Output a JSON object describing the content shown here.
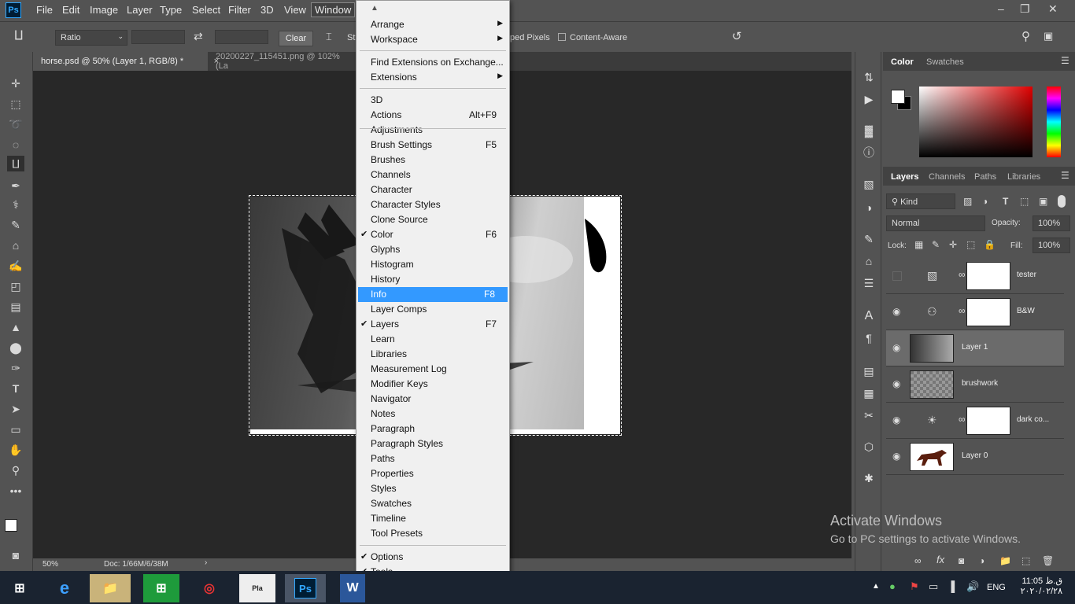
{
  "menubar": {
    "items": [
      "File",
      "Edit",
      "Image",
      "Layer",
      "Type",
      "Select",
      "Filter",
      "3D",
      "View",
      "Window"
    ],
    "active": "Window"
  },
  "options": {
    "ratio": "Ratio",
    "clear": "Clear",
    "delete_cropped": "ped Pixels",
    "content_aware": "Content-Aware",
    "st": "St"
  },
  "tabs": [
    {
      "label": "horse.psd @ 50% (Layer 1, RGB/8) *"
    },
    {
      "label": "20200227_115451.png @ 102% (La"
    }
  ],
  "status": {
    "zoom": "50%",
    "doc": "Doc: 1/66M/6/38M"
  },
  "window_menu": {
    "groups": [
      [
        {
          "label": "Arrange",
          "submenu": true
        },
        {
          "label": "Workspace",
          "submenu": true
        }
      ],
      [
        {
          "label": "Find Extensions on Exchange..."
        },
        {
          "label": "Extensions",
          "submenu": true
        }
      ],
      [
        {
          "label": "3D"
        },
        {
          "label": "Actions",
          "shortcut": "Alt+F9"
        },
        {
          "label": "Adjustments"
        },
        {
          "label": "Brush Settings",
          "shortcut": "F5"
        },
        {
          "label": "Brushes"
        },
        {
          "label": "Channels"
        },
        {
          "label": "Character"
        },
        {
          "label": "Character Styles"
        },
        {
          "label": "Clone Source"
        },
        {
          "label": "Color",
          "shortcut": "F6",
          "checked": true
        },
        {
          "label": "Glyphs"
        },
        {
          "label": "Histogram"
        },
        {
          "label": "History"
        },
        {
          "label": "Info",
          "shortcut": "F8",
          "highlighted": true
        },
        {
          "label": "Layer Comps"
        },
        {
          "label": "Layers",
          "shortcut": "F7",
          "checked": true
        },
        {
          "label": "Learn"
        },
        {
          "label": "Libraries"
        },
        {
          "label": "Measurement Log"
        },
        {
          "label": "Modifier Keys"
        },
        {
          "label": "Navigator"
        },
        {
          "label": "Notes"
        },
        {
          "label": "Paragraph"
        },
        {
          "label": "Paragraph Styles"
        },
        {
          "label": "Paths"
        },
        {
          "label": "Properties"
        },
        {
          "label": "Styles"
        },
        {
          "label": "Swatches"
        },
        {
          "label": "Timeline"
        },
        {
          "label": "Tool Presets"
        }
      ],
      [
        {
          "label": "Options",
          "checked": true
        },
        {
          "label": "Tools",
          "checked": true
        }
      ]
    ]
  },
  "color_panel": {
    "tabs": [
      "Color",
      "Swatches"
    ]
  },
  "layers_panel": {
    "tabs": [
      "Layers",
      "Channels",
      "Paths",
      "Libraries"
    ],
    "kind": "Kind",
    "blend": "Normal",
    "opacity_label": "Opacity:",
    "opacity": "100%",
    "lock_label": "Lock:",
    "fill_label": "Fill:",
    "fill": "100%",
    "layers": [
      {
        "name": "tester",
        "visible": false,
        "adj": true
      },
      {
        "name": "B&W",
        "visible": true,
        "adj": true
      },
      {
        "name": "Layer 1",
        "visible": true,
        "selected": true
      },
      {
        "name": "brushwork",
        "visible": true
      },
      {
        "name": "dark co...",
        "visible": true,
        "adj": true
      },
      {
        "name": "Layer 0",
        "visible": true
      }
    ]
  },
  "watermark": {
    "title": "Activate Windows",
    "subtitle": "Go to PC settings to activate Windows."
  },
  "taskbar": {
    "lang": "ENG",
    "time": "11:05 ق.ظ",
    "date": "٢٠٢٠/٠٢/٢٨",
    "ps": "Ps",
    "word": "W",
    "pl": "Pla"
  }
}
